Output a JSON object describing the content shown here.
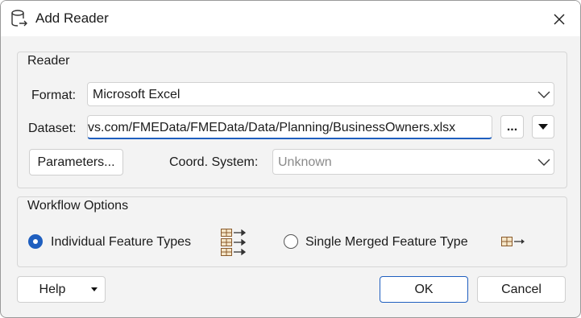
{
  "dialog": {
    "title": "Add Reader",
    "icons": {
      "app": "database-reader-icon",
      "close": "close-icon"
    }
  },
  "reader": {
    "group_label": "Reader",
    "format_label": "Format:",
    "format_value": "Microsoft Excel",
    "dataset_label": "Dataset:",
    "dataset_value": "vs.com/FMEData/FMEData/Data/Planning/BusinessOwners.xlsx",
    "browse_label": "...",
    "parameters_label": "Parameters...",
    "coord_label": "Coord. System:",
    "coord_value": "Unknown"
  },
  "workflow": {
    "group_label": "Workflow Options",
    "options": [
      {
        "label": "Individual Feature Types",
        "selected": true,
        "icon": "multiple-feature-types-icon"
      },
      {
        "label": "Single Merged Feature Type",
        "selected": false,
        "icon": "single-feature-type-icon"
      }
    ]
  },
  "footer": {
    "help_label": "Help",
    "ok_label": "OK",
    "cancel_label": "Cancel"
  },
  "colors": {
    "accent": "#1f5fbf",
    "table_icon": "#8a5a2b"
  }
}
